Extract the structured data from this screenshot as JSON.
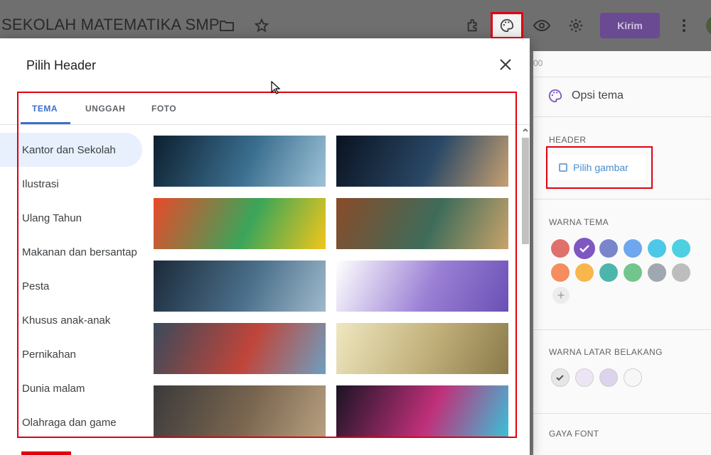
{
  "app": {
    "doc_title": "SEKOLAH MATEMATIKA SMP",
    "send_label": "Kirim",
    "icons": [
      "folder-icon",
      "star-icon",
      "addon-icon",
      "palette-icon",
      "eye-icon",
      "gear-icon",
      "more-vert-icon"
    ]
  },
  "side_panel": {
    "title": "Opsi tema",
    "header_label": "HEADER",
    "pick_image_label": "Pilih gambar",
    "theme_color_label": "WARNA TEMA",
    "theme_colors": [
      "#e0706b",
      "#7e57c2",
      "#7986cb",
      "#6ea6f0",
      "#4dc8e8",
      "#4dd0e1",
      "#f58d5e",
      "#f7b74d",
      "#4db6ac",
      "#72c58c",
      "#9fa8b0",
      "#bdbdbd"
    ],
    "bg_color_label": "WARNA LATAR BELAKANG",
    "font_style_label": "GAYA FONT",
    "partial_text": "00"
  },
  "modal": {
    "title": "Pilih Header",
    "tabs": [
      "TEMA",
      "UNGGAH",
      "FOTO"
    ],
    "active_tab": "TEMA",
    "categories": [
      "Kantor dan Sekolah",
      "Ilustrasi",
      "Ulang Tahun",
      "Makanan dan bersantap",
      "Pesta",
      "Khusus anak-anak",
      "Pernikahan",
      "Dunia malam",
      "Olahraga dan game"
    ],
    "active_category": "Kantor dan Sekolah",
    "thumbnails": [
      {
        "name": "fiber-optic-thumb",
        "colors": [
          "#0d1f2e",
          "#3b6f8f",
          "#9fc3d8"
        ]
      },
      {
        "name": "guitar-thumb",
        "colors": [
          "#0a1220",
          "#2a4866",
          "#c8a070"
        ]
      },
      {
        "name": "crayons-thumb",
        "colors": [
          "#e84a2a",
          "#3aa55a",
          "#f2c61a"
        ]
      },
      {
        "name": "yarn-thumb",
        "colors": [
          "#8a4b2a",
          "#3e6c5a",
          "#c9a36a"
        ]
      },
      {
        "name": "basketball-thumb",
        "colors": [
          "#1c2a3a",
          "#4a6f8a",
          "#9fb9cc"
        ]
      },
      {
        "name": "purple-spheres-thumb",
        "colors": [
          "#ffffff",
          "#9a7fd4",
          "#6a50b5"
        ]
      },
      {
        "name": "paint-hands-thumb",
        "colors": [
          "#3a4a5a",
          "#c0453a",
          "#6e9fc0"
        ]
      },
      {
        "name": "open-book-thumb",
        "colors": [
          "#efe7c0",
          "#bfae78",
          "#8a7a4a"
        ]
      },
      {
        "name": "brushes-thumb",
        "colors": [
          "#3a3a3a",
          "#7a6650",
          "#b8a080"
        ]
      },
      {
        "name": "lab-flasks-thumb",
        "colors": [
          "#1a1424",
          "#c0307a",
          "#3ac0d8"
        ]
      }
    ]
  }
}
